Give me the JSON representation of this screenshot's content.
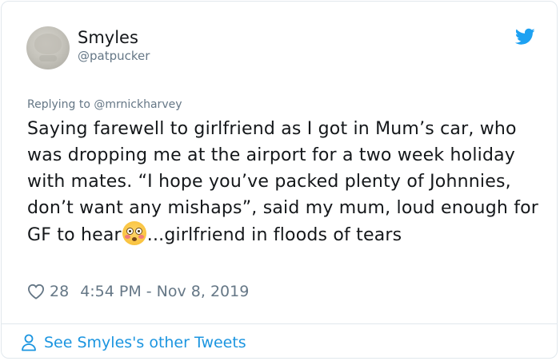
{
  "tweet": {
    "author": {
      "display_name": "Smyles",
      "handle": "@patpucker"
    },
    "reply_prefix": "Replying to ",
    "reply_to": "@mrnickharvey",
    "text_before_emoji": "Saying farewell to girlfriend as I got in Mum’s car, who was dropping me at the airport for a two week holiday with mates. “I hope you’ve packed plenty of Johnnies, don’t want any mishaps”, said my mum, loud enough for GF to hear",
    "emoji": "flushed-face",
    "text_after_emoji": "...girlfriend in floods of tears",
    "likes": "28",
    "timestamp": "4:54 PM - Nov 8, 2019"
  },
  "footer": {
    "link_label": "See Smyles's other Tweets"
  },
  "colors": {
    "text": "#14171a",
    "secondary": "#657786",
    "link": "#1b95e0",
    "twitter_blue": "#1da1f2",
    "border": "#e1e8ed"
  },
  "icons": {
    "brand": "twitter-bird-icon",
    "like": "heart-icon",
    "profile": "person-icon"
  }
}
